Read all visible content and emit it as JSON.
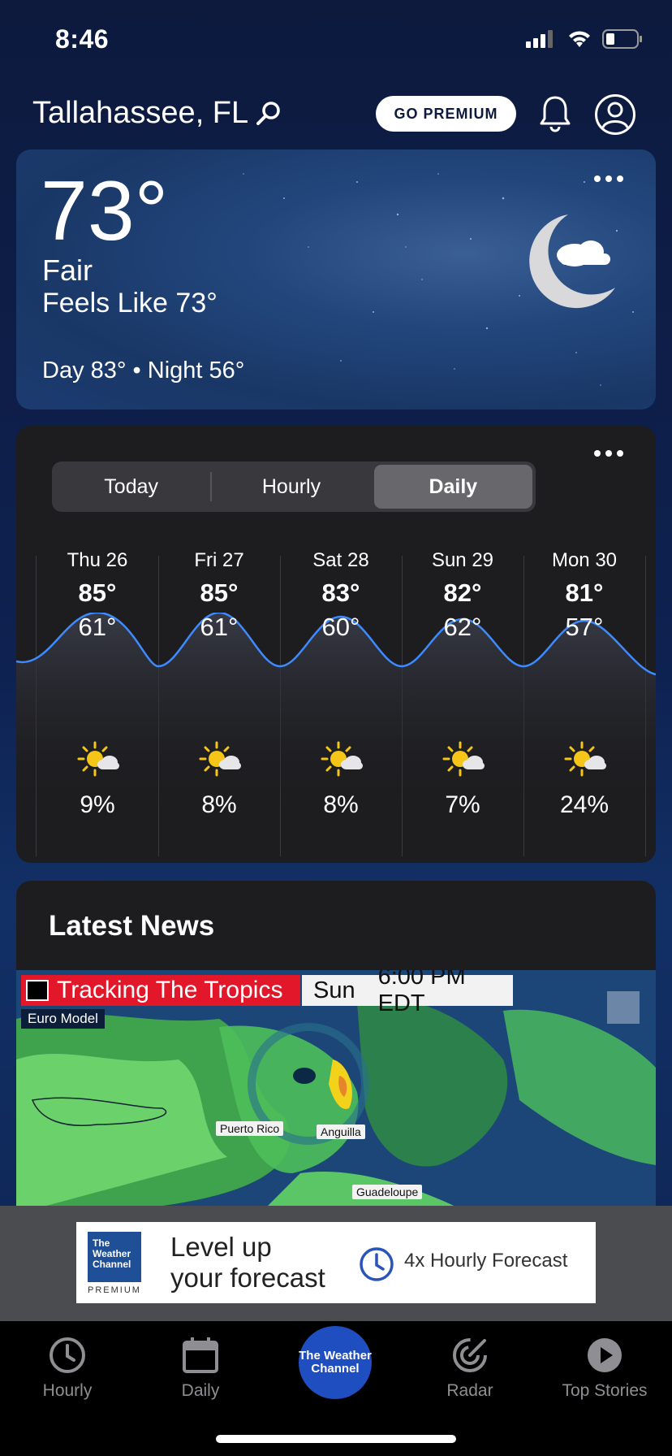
{
  "status_bar": {
    "time": "8:46"
  },
  "header": {
    "location": "Tallahassee, FL",
    "premium_label": "GO PREMIUM"
  },
  "current": {
    "temperature": "73°",
    "condition": "Fair",
    "feels_like": "Feels Like 73°",
    "day_night": "Day 83° • Night 56°",
    "icon": "moon-cloud-icon"
  },
  "forecast": {
    "tabs": [
      {
        "label": "Today",
        "active": false
      },
      {
        "label": "Hourly",
        "active": false
      },
      {
        "label": "Daily",
        "active": true
      }
    ],
    "days": [
      {
        "name": "Thu 26",
        "high": "85°",
        "low": "61°",
        "precip": "9%",
        "icon": "partly-sunny-icon"
      },
      {
        "name": "Fri 27",
        "high": "85°",
        "low": "61°",
        "precip": "8%",
        "icon": "partly-sunny-icon"
      },
      {
        "name": "Sat 28",
        "high": "83°",
        "low": "60°",
        "precip": "8%",
        "icon": "partly-sunny-icon"
      },
      {
        "name": "Sun 29",
        "high": "82°",
        "low": "62°",
        "precip": "7%",
        "icon": "partly-sunny-icon"
      },
      {
        "name": "Mon 30",
        "high": "81°",
        "low": "57°",
        "precip": "24%",
        "icon": "partly-sunny-icon"
      }
    ]
  },
  "news": {
    "title": "Latest News",
    "video": {
      "banner": "Tracking The Tropics",
      "day": "Sun",
      "time": "6:00 PM EDT",
      "model": "Euro Model",
      "places": [
        "Puerto Rico",
        "Anguilla",
        "Guadeloupe"
      ]
    }
  },
  "ad": {
    "logo_text": "The Weather Channel",
    "logo_sub": "PREMIUM",
    "headline_line1": "Level up",
    "headline_line2": "your forecast",
    "cta": "4x Hourly Forecast"
  },
  "tabbar": {
    "items": [
      {
        "label": "Hourly",
        "icon": "clock-icon"
      },
      {
        "label": "Daily",
        "icon": "calendar-icon"
      },
      {
        "label": "The Weather Channel",
        "icon": "twc-logo"
      },
      {
        "label": "Radar",
        "icon": "radar-icon"
      },
      {
        "label": "Top Stories",
        "icon": "play-icon"
      }
    ]
  },
  "colors": {
    "background": "#0d1a3e",
    "card_dark": "#1d1d20",
    "accent_blue": "#3d8bff",
    "sun_yellow": "#f5c518",
    "banner_red": "#e2172a"
  }
}
